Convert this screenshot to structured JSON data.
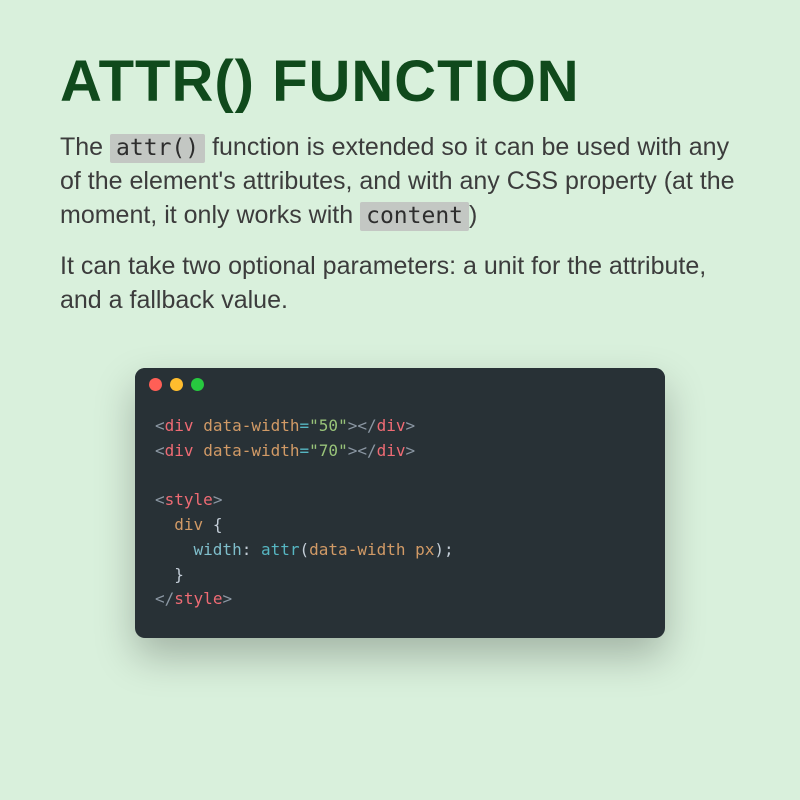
{
  "heading": "ATTR() FUNCTION",
  "para1": {
    "t1": "The ",
    "code1": "attr()",
    "t2": " function is extended so it can be used with any of the element's attributes, and with any CSS property (at the moment, it only works with ",
    "code2": "content",
    "t3": ")"
  },
  "para2": "It can take two optional parameters: a unit for the attribute, and a fallback value.",
  "code": {
    "line1": {
      "open_lt": "<",
      "tag": "div",
      "sp": " ",
      "attr": "data-width",
      "eq": "=",
      "q1": "\"",
      "val": "50",
      "q2": "\"",
      "close_gt": ">",
      "c_open_lt": "<",
      "c_slash": "/",
      "c_tag": "div",
      "c_gt": ">"
    },
    "line2": {
      "open_lt": "<",
      "tag": "div",
      "sp": " ",
      "attr": "data-width",
      "eq": "=",
      "q1": "\"",
      "val": "70",
      "q2": "\"",
      "close_gt": ">",
      "c_open_lt": "<",
      "c_slash": "/",
      "c_tag": "div",
      "c_gt": ">"
    },
    "style_open": {
      "lt": "<",
      "tag": "style",
      "gt": ">"
    },
    "rule": {
      "indent1": "  ",
      "selector": "div",
      "sp": " ",
      "brace_open": "{",
      "indent2": "    ",
      "prop": "width",
      "colon": ":",
      "sp2": " ",
      "func": "attr",
      "paren_open": "(",
      "arg": "data-width px",
      "paren_close": ")",
      "semi": ";",
      "indent3": "  ",
      "brace_close": "}"
    },
    "style_close": {
      "lt": "<",
      "slash": "/",
      "tag": "style",
      "gt": ">"
    }
  }
}
